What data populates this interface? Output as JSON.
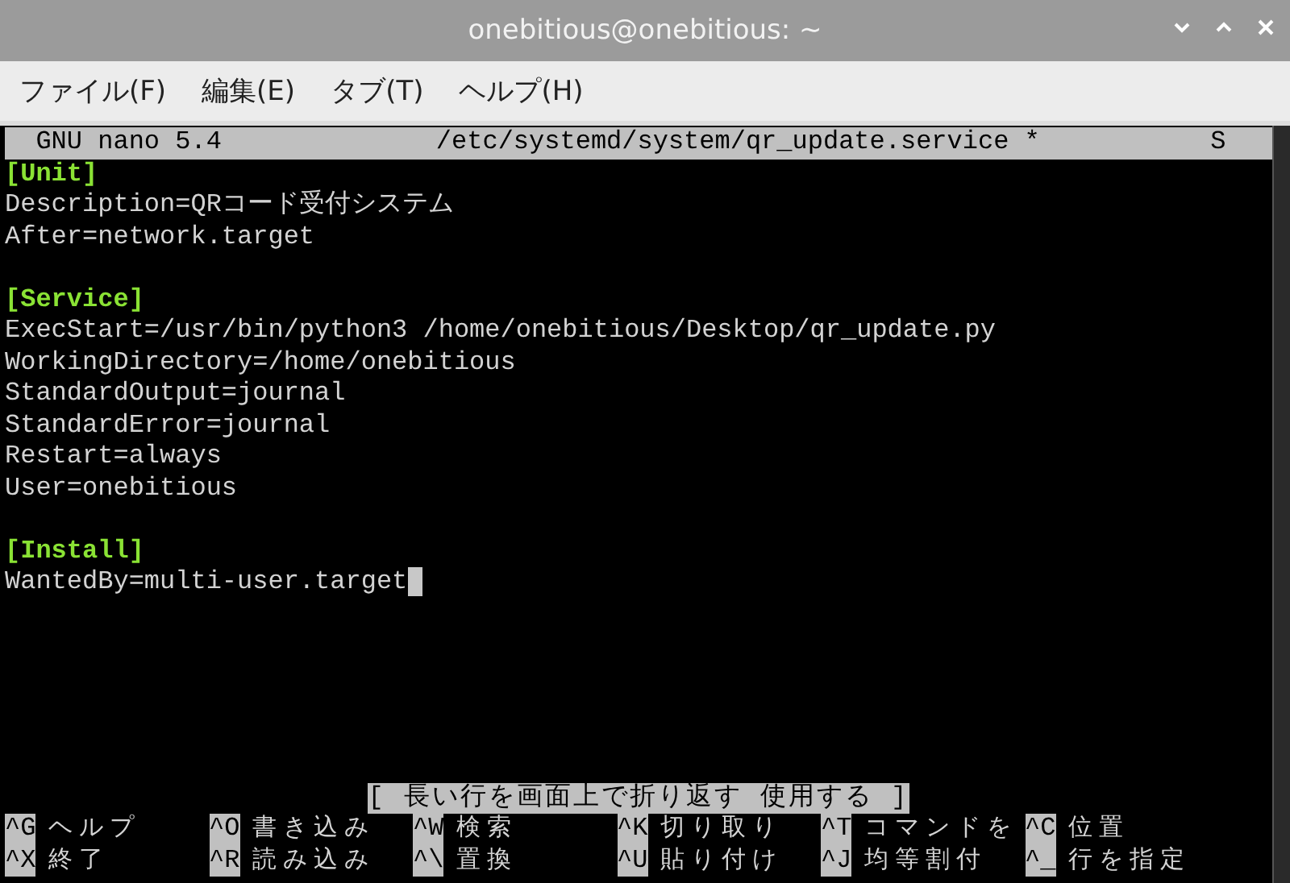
{
  "window": {
    "title": "onebitious@onebitious: ~"
  },
  "menu": [
    "ファイル(F)",
    "編集(E)",
    "タブ(T)",
    "ヘルプ(H)"
  ],
  "nano": {
    "version": "GNU nano 5.4",
    "file": "/etc/systemd/system/qr_update.service *",
    "flag": "S",
    "lines": [
      {
        "kind": "section",
        "text": "[Unit]",
        "cursor": false
      },
      {
        "kind": "text",
        "text": "Description=QRコード受付システム",
        "cursor": false
      },
      {
        "kind": "text",
        "text": "After=network.target",
        "cursor": false
      },
      {
        "kind": "blank"
      },
      {
        "kind": "section",
        "text": "[Service]",
        "cursor": false
      },
      {
        "kind": "text",
        "text": "ExecStart=/usr/bin/python3 /home/onebitious/Desktop/qr_update.py",
        "cursor": false
      },
      {
        "kind": "text",
        "text": "WorkingDirectory=/home/onebitious",
        "cursor": false
      },
      {
        "kind": "text",
        "text": "StandardOutput=journal",
        "cursor": false
      },
      {
        "kind": "text",
        "text": "StandardError=journal",
        "cursor": false
      },
      {
        "kind": "text",
        "text": "Restart=always",
        "cursor": false
      },
      {
        "kind": "text",
        "text": "User=onebitious",
        "cursor": false
      },
      {
        "kind": "blank"
      },
      {
        "kind": "section",
        "text": "[Install]",
        "cursor": false
      },
      {
        "kind": "text",
        "text": "WantedBy=multi-user.target",
        "cursor": true
      }
    ],
    "status": "[ 長い行を画面上で折り返す 使用する ]",
    "shortcuts": [
      [
        {
          "key": "^G",
          "label": "ヘルプ"
        },
        {
          "key": "^O",
          "label": "書き込み"
        },
        {
          "key": "^W",
          "label": "検索"
        },
        {
          "key": "^K",
          "label": "切り取り"
        },
        {
          "key": "^T",
          "label": "コマンドを"
        },
        {
          "key": "^C",
          "label": "位置"
        }
      ],
      [
        {
          "key": "^X",
          "label": "終了"
        },
        {
          "key": "^R",
          "label": "読み込み"
        },
        {
          "key": "^\\",
          "label": "置換"
        },
        {
          "key": "^U",
          "label": "貼り付け"
        },
        {
          "key": "^J",
          "label": "均等割付"
        },
        {
          "key": "^_",
          "label": "行を指定"
        }
      ]
    ]
  }
}
